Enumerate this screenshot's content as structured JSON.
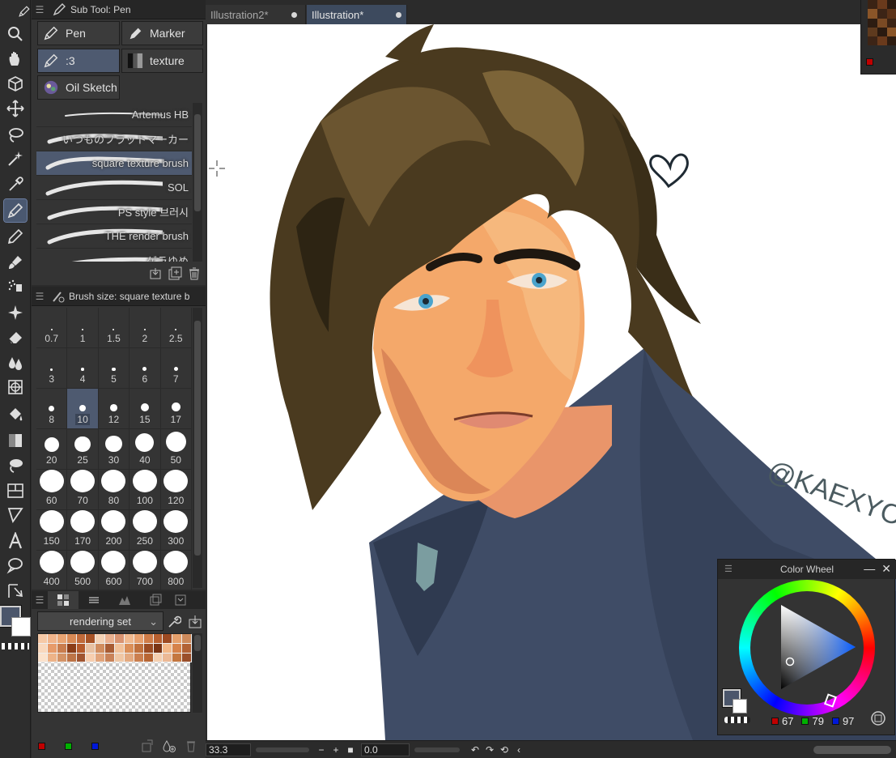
{
  "subtool_panel": {
    "title": "Sub Tool: Pen",
    "categories": [
      {
        "label": "Pen",
        "icon": "pen-icon"
      },
      {
        "label": "Marker",
        "icon": "marker-icon"
      },
      {
        "label": ":3",
        "icon": "pen-icon"
      },
      {
        "label": "texture",
        "icon": "texture-icon"
      },
      {
        "label": "Oil Sketch",
        "icon": "oil-sketch-icon"
      }
    ],
    "active_category": ":3",
    "brushes": [
      {
        "label": "Artemus HB"
      },
      {
        "label": "いつものフラットマーカー"
      },
      {
        "label": "square texture brush"
      },
      {
        "label": "SOL"
      },
      {
        "label": "PS style 브러시"
      },
      {
        "label": "THE render brush"
      },
      {
        "label": "ゲラゆめ"
      }
    ],
    "active_brush": "square texture brush"
  },
  "brush_size_panel": {
    "title": "Brush size: square texture b",
    "sizes": [
      "0.7",
      "1",
      "1.5",
      "2",
      "2.5",
      "3",
      "4",
      "5",
      "6",
      "7",
      "8",
      "10",
      "12",
      "15",
      "17",
      "20",
      "25",
      "30",
      "40",
      "50",
      "60",
      "70",
      "80",
      "100",
      "120",
      "150",
      "170",
      "200",
      "250",
      "300",
      "400",
      "500",
      "600",
      "700",
      "800"
    ],
    "active_size": "10"
  },
  "color_set_panel": {
    "selected_set": "rendering set",
    "swatches": [
      "#f6c9a6",
      "#f1b48a",
      "#e9a472",
      "#d98a55",
      "#c06a3a",
      "#a85326",
      "#f4d2b5",
      "#eab08f",
      "#d99370",
      "#f0b98f",
      "#e7a06e",
      "#cf7c48",
      "#b86030",
      "#9d4a22",
      "#e6a06c",
      "#ce8a5b",
      "#f9d8bd",
      "#e79b6a",
      "#c97d4e",
      "#8b3d18",
      "#b55a2b",
      "#e8c1a2",
      "#d18d5f",
      "#a85c34",
      "#f2c29a",
      "#db8f58",
      "#c0703c",
      "#9b4b22",
      "#7a3515",
      "#f3b888",
      "#d6824a",
      "#b26235",
      "#fbe2cc",
      "#edb388",
      "#d49366",
      "#bd7447",
      "#a05430",
      "#f7ceaf",
      "#e2a47b",
      "#c98258",
      "#f0c7a4",
      "#e4aa80",
      "#cb7f4f",
      "#b86634",
      "#f5cfb0",
      "#ecb995",
      "#c4773f",
      "#9a4f2a"
    ]
  },
  "colors": {
    "main": "#4b566b",
    "sub": "#ffffff",
    "accent": "#4e5a70"
  },
  "document_tabs": [
    {
      "label": "Illustration2*",
      "active": false
    },
    {
      "label": "Illustration*",
      "active": true
    }
  ],
  "color_wheel": {
    "title": "Color Wheel",
    "r": "67",
    "g": "79",
    "b": "97"
  },
  "status_bar": {
    "zoom": "33.3",
    "rotation": "0.0"
  },
  "canvas": {
    "signature": "@KAEXYOL"
  },
  "tools": [
    "magnifier-icon",
    "hand-icon",
    "object-icon",
    "move-icon",
    "lasso-icon",
    "magic-wand-icon",
    "eyedropper-icon",
    "pen-icon",
    "pencil-icon",
    "brush-icon",
    "airbrush-icon",
    "decoration-icon",
    "eraser-icon",
    "blend-icon",
    "figure-icon",
    "fill-icon",
    "gradient-icon",
    "lasso-fill-icon",
    "frame-icon",
    "ruler-icon",
    "text-icon",
    "balloon-icon",
    "correct-line-icon"
  ],
  "active_tool": "pen-icon"
}
